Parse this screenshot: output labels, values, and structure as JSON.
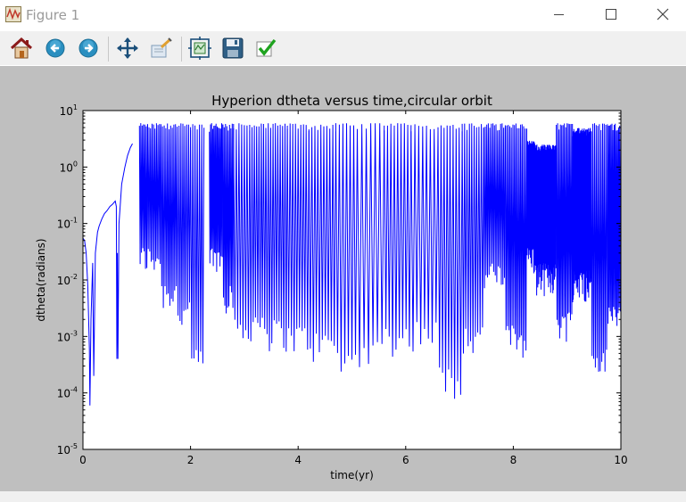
{
  "window": {
    "title": "Figure 1",
    "controls": [
      "minimize",
      "maximize",
      "close"
    ]
  },
  "toolbar": {
    "buttons": [
      {
        "name": "home",
        "icon": "home-icon"
      },
      {
        "name": "back",
        "icon": "arrow-left-icon"
      },
      {
        "name": "forward",
        "icon": "arrow-right-icon"
      },
      {
        "name": "pan",
        "icon": "move-icon"
      },
      {
        "name": "zoom",
        "icon": "zoom-rect-icon"
      },
      {
        "name": "configure-subplots",
        "icon": "subplots-icon"
      },
      {
        "name": "save",
        "icon": "floppy-disk-icon"
      },
      {
        "name": "edit-axis",
        "icon": "checkmark-icon"
      }
    ]
  },
  "colors": {
    "figure_bg": "#bfbfbf",
    "line": "#0000ff",
    "axes_bg": "#ffffff"
  },
  "chart_data": {
    "type": "line",
    "title": "Hyperion dtheta versus time,circular orbit",
    "xlabel": "time(yr)",
    "ylabel": "dtheta(radians)",
    "xlim": [
      0,
      10
    ],
    "ylim": [
      1e-05,
      10
    ],
    "yscale": "log",
    "xticks": [
      "0",
      "2",
      "4",
      "6",
      "8",
      "10"
    ],
    "yticks": [
      {
        "base": "10",
        "exp": "1"
      },
      {
        "base": "10",
        "exp": "0"
      },
      {
        "base": "10",
        "exp": "-1"
      },
      {
        "base": "10",
        "exp": "-2"
      },
      {
        "base": "10",
        "exp": "-3"
      },
      {
        "base": "10",
        "exp": "-4"
      },
      {
        "base": "10",
        "exp": "-5"
      }
    ],
    "grid": false,
    "legend": "none",
    "series": [
      {
        "points": [
          [
            0.0,
            0.055
          ],
          [
            0.03,
            0.05
          ],
          [
            0.06,
            0.03
          ],
          [
            0.09,
            0.008
          ],
          [
            0.12,
            0.0006
          ],
          [
            0.13,
            6e-05
          ],
          [
            0.15,
            0.002
          ],
          [
            0.18,
            0.02
          ],
          [
            0.2,
            0.0002
          ],
          [
            0.23,
            0.03
          ],
          [
            0.27,
            0.07
          ],
          [
            0.3,
            0.09
          ],
          [
            0.35,
            0.12
          ],
          [
            0.4,
            0.15
          ],
          [
            0.45,
            0.17
          ],
          [
            0.5,
            0.2
          ],
          [
            0.55,
            0.22
          ],
          [
            0.6,
            0.25
          ],
          [
            0.62,
            0.2
          ],
          [
            0.63,
            0.0004
          ],
          [
            0.64,
            0.03
          ],
          [
            0.65,
            0.0004
          ],
          [
            0.67,
            0.1
          ],
          [
            0.72,
            0.5
          ],
          [
            0.78,
            1.0
          ],
          [
            0.83,
            1.6
          ],
          [
            0.88,
            2.2
          ],
          [
            0.92,
            2.6
          ]
        ]
      },
      {
        "mode": "oscillation",
        "amplitude_high": 6,
        "segments": [
          {
            "x0": 1.05,
            "x1": 1.2,
            "n": 6,
            "low": 0.02
          },
          {
            "x0": 1.2,
            "x1": 1.45,
            "n": 9,
            "low": 0.02
          },
          {
            "x0": 1.45,
            "x1": 1.75,
            "n": 10,
            "low": 0.005
          },
          {
            "x0": 1.75,
            "x1": 2.0,
            "n": 7,
            "low": 0.002
          },
          {
            "x0": 2.0,
            "x1": 2.25,
            "n": 6,
            "low": 0.0003
          },
          {
            "x0": 2.35,
            "x1": 2.6,
            "n": 12,
            "low": 0.02
          },
          {
            "x0": 2.6,
            "x1": 2.8,
            "n": 8,
            "low": 0.005
          },
          {
            "x0": 2.8,
            "x1": 3.1,
            "n": 6,
            "low": 0.001
          },
          {
            "x0": 3.1,
            "x1": 3.4,
            "n": 7,
            "low": 0.0015
          },
          {
            "x0": 3.4,
            "x1": 3.8,
            "n": 9,
            "low": 0.001
          },
          {
            "x0": 3.8,
            "x1": 4.2,
            "n": 8,
            "low": 0.0008
          },
          {
            "x0": 4.2,
            "x1": 4.7,
            "n": 9,
            "low": 0.0006
          },
          {
            "x0": 4.7,
            "x1": 5.1,
            "n": 6,
            "low": 0.0003
          },
          {
            "x0": 5.1,
            "x1": 5.6,
            "n": 6,
            "low": 0.0005
          },
          {
            "x0": 5.6,
            "x1": 6.1,
            "n": 8,
            "low": 0.0008
          },
          {
            "x0": 6.1,
            "x1": 6.6,
            "n": 7,
            "low": 0.001
          },
          {
            "x0": 6.6,
            "x1": 7.05,
            "n": 8,
            "low": 0.00015
          },
          {
            "x0": 7.05,
            "x1": 7.45,
            "n": 9,
            "low": 0.0008
          },
          {
            "x0": 7.45,
            "x1": 7.85,
            "n": 14,
            "low": 0.01
          },
          {
            "x0": 7.85,
            "x1": 8.25,
            "n": 14,
            "low": 0.0008
          },
          {
            "x0": 8.25,
            "x1": 8.4,
            "n": 12,
            "low": 0.02,
            "high": 3
          },
          {
            "x0": 8.4,
            "x1": 8.8,
            "n": 40,
            "low": 0.01,
            "high": 2.5
          },
          {
            "x0": 8.8,
            "x1": 9.1,
            "n": 12,
            "low": 0.0015
          },
          {
            "x0": 9.1,
            "x1": 9.45,
            "n": 40,
            "low": 0.008,
            "high": 5
          },
          {
            "x0": 9.45,
            "x1": 9.75,
            "n": 10,
            "low": 0.0003
          },
          {
            "x0": 9.75,
            "x1": 10.0,
            "n": 12,
            "low": 0.002
          }
        ]
      }
    ]
  }
}
